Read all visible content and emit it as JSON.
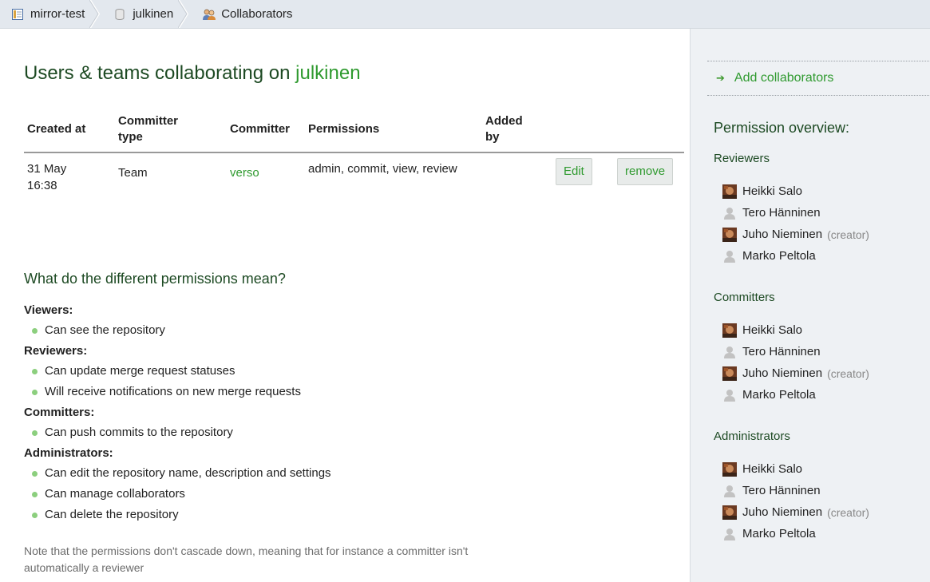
{
  "breadcrumb": [
    {
      "label": "mirror-test",
      "icon": "project-icon"
    },
    {
      "label": "julkinen",
      "icon": "repository-icon"
    },
    {
      "label": "Collaborators",
      "icon": "collaborators-icon"
    }
  ],
  "page": {
    "title_prefix": "Users & teams collaborating on ",
    "repo_name": "julkinen"
  },
  "table": {
    "headers": {
      "created_at": "Created at",
      "committer_type": "Committer type",
      "committer": "Committer",
      "permissions": "Permissions",
      "added_by": "Added by"
    },
    "rows": [
      {
        "created_at": "31 May 16:38",
        "committer_type": "Team",
        "committer": "verso",
        "permissions": "admin, commit, view, review",
        "added_by": "",
        "edit_label": "Edit",
        "remove_label": "remove"
      }
    ]
  },
  "permissions_help": {
    "title": "What do the different permissions mean?",
    "groups": [
      {
        "name": "Viewers:",
        "items": [
          "Can see the repository"
        ]
      },
      {
        "name": "Reviewers:",
        "items": [
          "Can update merge request statuses",
          "Will receive notifications on new merge requests"
        ]
      },
      {
        "name": "Committers:",
        "items": [
          "Can push commits to the repository"
        ]
      },
      {
        "name": "Administrators:",
        "items": [
          "Can edit the repository name, description and settings",
          "Can manage collaborators",
          "Can delete the repository"
        ]
      }
    ],
    "note": "Note that the permissions don't cascade down, meaning that for instance a committer isn't automatically a reviewer"
  },
  "sidebar": {
    "add_label": "Add collaborators",
    "overview_title": "Permission overview:",
    "creator_tag": "(creator)",
    "groups": [
      {
        "title": "Reviewers",
        "members": [
          {
            "name": "Heikki Salo",
            "avatar": "photo",
            "creator": false
          },
          {
            "name": "Tero Hänninen",
            "avatar": "default",
            "creator": false
          },
          {
            "name": "Juho Nieminen",
            "avatar": "photo",
            "creator": true
          },
          {
            "name": "Marko Peltola",
            "avatar": "default",
            "creator": false
          }
        ]
      },
      {
        "title": "Committers",
        "members": [
          {
            "name": "Heikki Salo",
            "avatar": "photo",
            "creator": false
          },
          {
            "name": "Tero Hänninen",
            "avatar": "default",
            "creator": false
          },
          {
            "name": "Juho Nieminen",
            "avatar": "photo",
            "creator": true
          },
          {
            "name": "Marko Peltola",
            "avatar": "default",
            "creator": false
          }
        ]
      },
      {
        "title": "Administrators",
        "members": [
          {
            "name": "Heikki Salo",
            "avatar": "photo",
            "creator": false
          },
          {
            "name": "Tero Hänninen",
            "avatar": "default",
            "creator": false
          },
          {
            "name": "Juho Nieminen",
            "avatar": "photo",
            "creator": true
          },
          {
            "name": "Marko Peltola",
            "avatar": "default",
            "creator": false
          }
        ]
      }
    ]
  },
  "colors": {
    "link_green": "#2f9a2f",
    "heading_green": "#1d4a23",
    "sidebar_bg": "#eef1f4"
  }
}
